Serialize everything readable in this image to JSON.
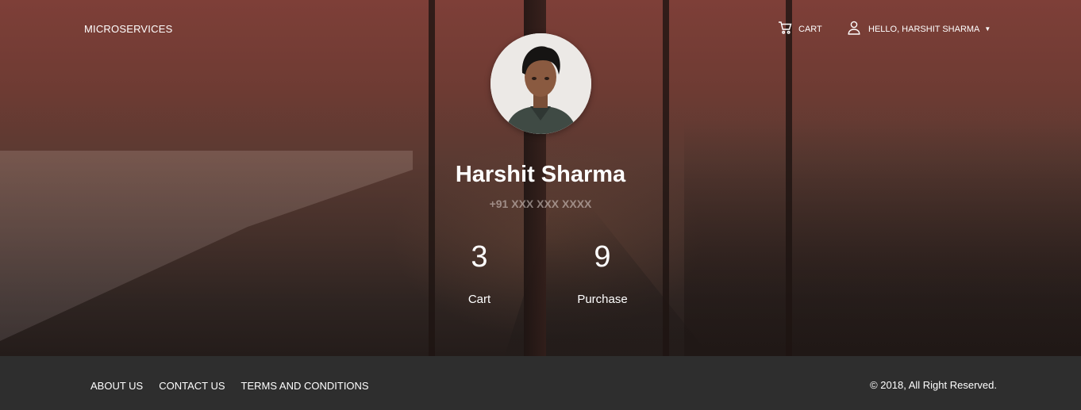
{
  "nav": {
    "brand": "MICROSERVICES",
    "cart_label": "CART",
    "user_label": "HELLO, HARSHIT SHARMA",
    "user_caret": "▼"
  },
  "profile": {
    "name": "Harshit Sharma",
    "phone": "+91 XXX XXX XXXX",
    "stats": [
      {
        "value": "3",
        "label": "Cart"
      },
      {
        "value": "9",
        "label": "Purchase"
      }
    ]
  },
  "footer": {
    "links": [
      "ABOUT US",
      "CONTACT US",
      "TERMS AND CONDITIONS"
    ],
    "copyright": "© 2018, All Right Reserved."
  },
  "colors": {
    "hero_top": "#7e3f38",
    "hero_bottom": "#241c1a",
    "footer_bg": "#2e2e2e",
    "text": "#ffffff"
  },
  "icons": {
    "cart": "cart-icon",
    "user": "user-icon"
  }
}
